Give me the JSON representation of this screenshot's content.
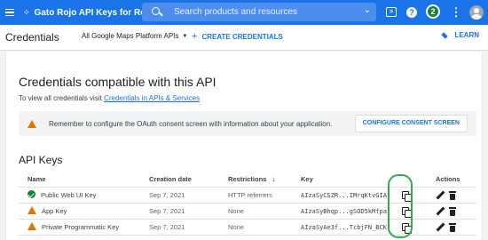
{
  "topbar": {
    "project_name": "Gato Rojo API Keys for Redcat",
    "search_placeholder": "Search products and resources",
    "notification_count": "2",
    "colors": {
      "bar": "#1a73e8"
    }
  },
  "subbar": {
    "title": "Credentials",
    "filter_label": "All Google Maps Platform APIs",
    "create_label": "CREATE CREDENTIALS",
    "learn_label": "LEARN"
  },
  "main": {
    "heading": "Credentials compatible with this API",
    "desc_prefix": "To view all credentials visit ",
    "desc_link": "Credentials in APIs & Services",
    "warning_text": "Remember to configure the OAuth consent screen with information about your application.",
    "configure_button": "CONFIGURE CONSENT SCREEN",
    "section_title": "API Keys"
  },
  "table": {
    "headers": {
      "name": "Name",
      "date": "Creation date",
      "restrictions": "Restrictions",
      "key": "Key",
      "actions": "Actions"
    },
    "rows": [
      {
        "status": "ok",
        "name": "Public Web UI Key",
        "date": "Sep 7, 2021",
        "restrictions": "HTTP referrers",
        "key": "AIzaSyCSZR...IMrqKtvGIA"
      },
      {
        "status": "warning",
        "name": "App Key",
        "date": "Sep 7, 2021",
        "restrictions": "None",
        "key": "AIzaSyBhqp...gSOD5kMfpa"
      },
      {
        "status": "warning",
        "name": "Private Programmatic Key",
        "date": "Sep 7, 2021",
        "restrictions": "None",
        "key": "AIzaSyAe3f...TcbjFN_BCK"
      }
    ]
  },
  "icons": [
    "hamburger-icon",
    "search-icon",
    "terminal-icon",
    "help-icon",
    "more-vert-icon",
    "avatar",
    "plus-icon",
    "school-icon",
    "warning-icon",
    "check-circle-icon",
    "copy-icon",
    "edit-icon",
    "delete-icon",
    "arrow-down-icon"
  ]
}
